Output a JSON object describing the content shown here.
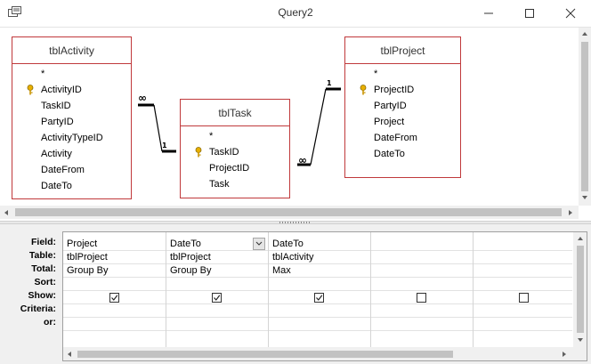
{
  "window": {
    "title": "Query2"
  },
  "tables": {
    "activity": {
      "name": "tblActivity",
      "fields": [
        "*",
        "ActivityID",
        "TaskID",
        "PartyID",
        "ActivityTypeID",
        "Activity",
        "DateFrom",
        "DateTo"
      ],
      "key_field": "ActivityID"
    },
    "task": {
      "name": "tblTask",
      "fields": [
        "*",
        "TaskID",
        "ProjectID",
        "Task"
      ],
      "key_field": "TaskID"
    },
    "project": {
      "name": "tblProject",
      "fields": [
        "*",
        "ProjectID",
        "PartyID",
        "Project",
        "DateFrom",
        "DateTo"
      ],
      "key_field": "ProjectID"
    }
  },
  "relationships": [
    {
      "from": "tblTask",
      "to": "tblActivity",
      "one_label": "1",
      "many_label": "∞"
    },
    {
      "from": "tblProject",
      "to": "tblTask",
      "one_label": "1",
      "many_label": "∞"
    }
  ],
  "grid": {
    "row_labels": [
      "Field:",
      "Table:",
      "Total:",
      "Sort:",
      "Show:",
      "Criteria:",
      "or:"
    ],
    "columns": [
      {
        "field": "Project",
        "table": "tblProject",
        "total": "Group By",
        "sort": "",
        "show": true,
        "criteria": "",
        "or": ""
      },
      {
        "field": "DateTo",
        "table": "tblProject",
        "total": "Group By",
        "sort": "",
        "show": true,
        "criteria": "",
        "or": ""
      },
      {
        "field": "DateTo",
        "table": "tblActivity",
        "total": "Max",
        "sort": "",
        "show": true,
        "criteria": "",
        "or": ""
      },
      {
        "field": "",
        "table": "",
        "total": "",
        "sort": "",
        "show": false,
        "criteria": "",
        "or": ""
      },
      {
        "field": "",
        "table": "",
        "total": "",
        "sort": "",
        "show": false,
        "criteria": "",
        "or": ""
      }
    ]
  },
  "colors": {
    "table_border": "#c0393b",
    "key_icon": "#d9a400"
  },
  "icons": [
    "app-icon",
    "minimize-icon",
    "maximize-icon",
    "close-icon",
    "key-icon",
    "checkbox",
    "dropdown-arrow-icon",
    "scroll-left-icon",
    "scroll-right-icon",
    "scroll-up-icon",
    "scroll-down-icon"
  ]
}
